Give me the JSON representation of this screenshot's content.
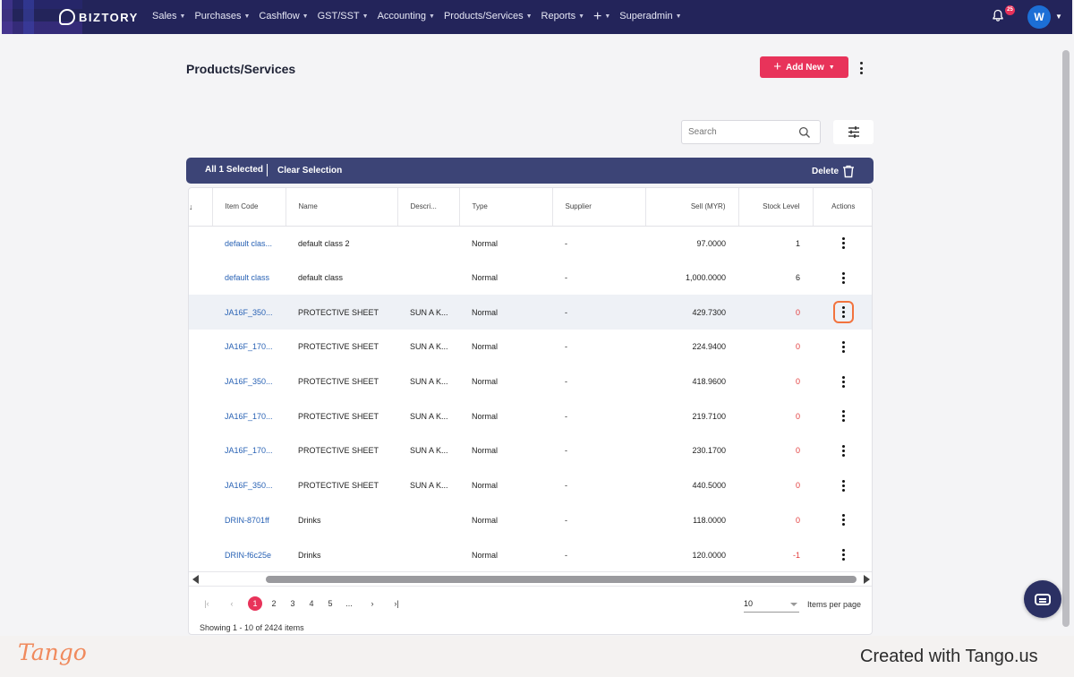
{
  "nav": {
    "brand": "BIZTORY",
    "menu": [
      "Sales",
      "Purchases",
      "Cashflow",
      "GST/SST",
      "Accounting",
      "Products/Services",
      "Reports",
      "+",
      "Superadmin"
    ],
    "notification_count": "25",
    "avatar_initial": "W"
  },
  "page": {
    "title": "Products/Services",
    "add_new_label": "Add New",
    "search_placeholder": "Search"
  },
  "selection_bar": {
    "selected_label": "All 1 Selected",
    "clear_label": "Clear Selection",
    "delete_label": "Delete"
  },
  "table": {
    "columns": [
      "Item Code",
      "Name",
      "Descri...",
      "Type",
      "Supplier",
      "Sell (MYR)",
      "Stock Level",
      "Actions"
    ],
    "rows": [
      {
        "code": "default clas...",
        "name": "default class 2",
        "desc": "",
        "type": "Normal",
        "supplier": "-",
        "sell": "97.0000",
        "stock": "1"
      },
      {
        "code": "default class",
        "name": "default class",
        "desc": "",
        "type": "Normal",
        "supplier": "-",
        "sell": "1,000.0000",
        "stock": "6"
      },
      {
        "code": "JA16F_350...",
        "name": "PROTECTIVE SHEET",
        "desc": "SUN A K...",
        "type": "Normal",
        "supplier": "-",
        "sell": "429.7300",
        "stock": "0"
      },
      {
        "code": "JA16F_170...",
        "name": "PROTECTIVE SHEET",
        "desc": "SUN A K...",
        "type": "Normal",
        "supplier": "-",
        "sell": "224.9400",
        "stock": "0"
      },
      {
        "code": "JA16F_350...",
        "name": "PROTECTIVE SHEET",
        "desc": "SUN A K...",
        "type": "Normal",
        "supplier": "-",
        "sell": "418.9600",
        "stock": "0"
      },
      {
        "code": "JA16F_170...",
        "name": "PROTECTIVE SHEET",
        "desc": "SUN A K...",
        "type": "Normal",
        "supplier": "-",
        "sell": "219.7100",
        "stock": "0"
      },
      {
        "code": "JA16F_170...",
        "name": "PROTECTIVE SHEET",
        "desc": "SUN A K...",
        "type": "Normal",
        "supplier": "-",
        "sell": "230.1700",
        "stock": "0"
      },
      {
        "code": "JA16F_350...",
        "name": "PROTECTIVE SHEET",
        "desc": "SUN A K...",
        "type": "Normal",
        "supplier": "-",
        "sell": "440.5000",
        "stock": "0"
      },
      {
        "code": "DRIN-8701ff",
        "name": "Drinks",
        "desc": "",
        "type": "Normal",
        "supplier": "-",
        "sell": "118.0000",
        "stock": "0"
      },
      {
        "code": "DRIN-f6c25e",
        "name": "Drinks",
        "desc": "",
        "type": "Normal",
        "supplier": "-",
        "sell": "120.0000",
        "stock": "-1"
      }
    ]
  },
  "pagination": {
    "pages": [
      "1",
      "2",
      "3",
      "4",
      "5",
      "..."
    ],
    "first": "|‹",
    "prev": "‹",
    "next": "›",
    "last": "›|",
    "per_page_value": "10",
    "per_page_label": "Items per page",
    "showing": "Showing 1 - 10 of 2424 items"
  },
  "footer": {
    "logo": "Tango",
    "credit": "Created with Tango.us"
  },
  "colors": {
    "nav_bg": "#23245a",
    "accent": "#e8335a",
    "selection_bar": "#3c4476",
    "link": "#2a63b5",
    "negative_stock": "#e23b3b",
    "focus_ring": "#f2733e"
  }
}
